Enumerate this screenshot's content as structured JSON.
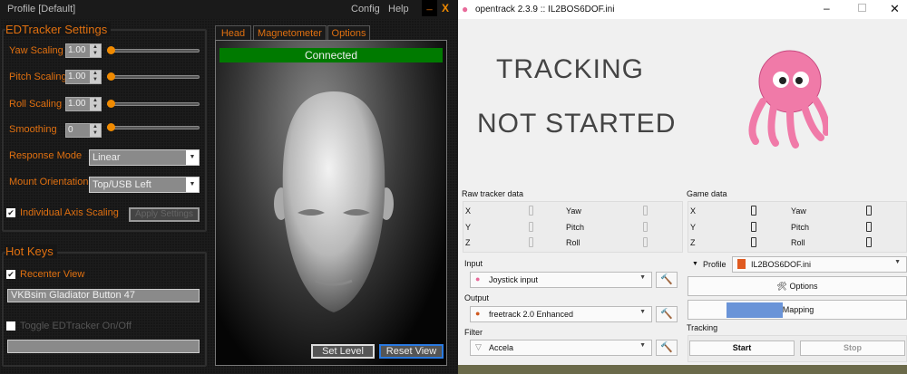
{
  "edtracker": {
    "title": "Profile [Default]",
    "menu": [
      "Config",
      "Help"
    ],
    "minimize": "_",
    "close": "X",
    "settings_title": "EDTracker Settings",
    "rows": [
      {
        "label": "Yaw Scaling",
        "value": "1.00",
        "slider": 0
      },
      {
        "label": "Pitch Scaling",
        "value": "1.00",
        "slider": 0
      },
      {
        "label": "Roll Scaling",
        "value": "1.00",
        "slider": 0
      },
      {
        "label": "Smoothing",
        "value": "0",
        "slider": 0
      }
    ],
    "response_mode_label": "Response Mode",
    "response_mode": "Linear",
    "mount_label": "Mount Orientation",
    "mount": "Top/USB Left",
    "individual_axis": "Individual Axis Scaling",
    "individual_axis_checked": true,
    "apply": "Apply Settings",
    "hotkeys_title": "Hot Keys",
    "recenter": "Recenter View",
    "recenter_checked": true,
    "recenter_key": "VKBsim Gladiator  Button 47",
    "toggle": "Toggle EDTracker On/Off",
    "toggle_checked": false,
    "toggle_key": "",
    "tabs": [
      "Head",
      "Magnetometer",
      "Options"
    ],
    "status": "Connected",
    "set_level": "Set Level",
    "reset_view": "Reset View"
  },
  "opentrack": {
    "title": "opentrack 2.3.9 :: IL2BOS6DOF.ini",
    "status_line1": "TRACKING",
    "status_line2": "NOT STARTED",
    "raw_title": "Raw tracker data",
    "game_title": "Game data",
    "axes_left": [
      "X",
      "Y",
      "Z"
    ],
    "axes_right": [
      "Yaw",
      "Pitch",
      "Roll"
    ],
    "input_label": "Input",
    "input": "Joystick input",
    "output_label": "Output",
    "output": "freetrack 2.0 Enhanced",
    "filter_label": "Filter",
    "filter": "Accela",
    "profile_label": "Profile",
    "profile": "IL2BOS6DOF.ini",
    "options": "Options",
    "mapping": "Mapping",
    "tracking_label": "Tracking",
    "start": "Start",
    "stop": "Stop"
  }
}
